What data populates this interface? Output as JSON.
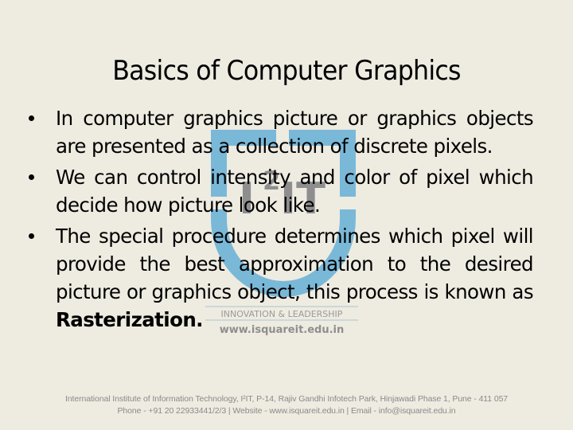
{
  "slide": {
    "title": "Basics of Computer Graphics",
    "bullets": [
      {
        "text": "In computer graphics picture or graphics objects are presented as a collection of discrete pixels."
      },
      {
        "text": "We can control intensity and color of pixel which decide how picture look like."
      },
      {
        "text_before": "The special procedure determines which pixel will provide the best approximation to the desired picture or graphics object, this process is known as ",
        "bold": "Rasterization."
      }
    ]
  },
  "watermark": {
    "logo_text": "I",
    "logo_superscript": "2",
    "logo_text_end": "IT",
    "tagline": "INNOVATION & LEADERSHIP",
    "website": "www.isquareit.edu.in",
    "colors": {
      "bracket": "#7ab8d8",
      "logo_text": "#8e8e8e"
    }
  },
  "footer": {
    "line1": "International Institute of Information Technology, I²IT, P-14, Rajiv Gandhi Infotech Park, Hinjawadi Phase 1, Pune - 411 057",
    "line2": "Phone - +91 20 22933441/2/3 | Website - www.isquareit.edu.in | Email - info@isquareit.edu.in"
  }
}
